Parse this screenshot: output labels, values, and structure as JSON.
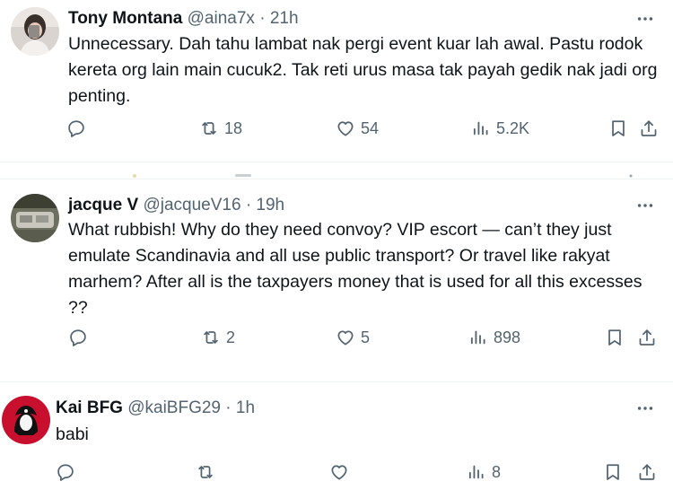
{
  "tweets": [
    {
      "name": "Tony Montana",
      "handle": "@aina7x",
      "dot": "·",
      "time": "21h",
      "text": "Unnecessary. Dah tahu lambat nak pergi event kuar lah awal. Pastu rodok kereta org lain main cucuk2. Tak reti urus masa tak payah gedik nak jadi org penting.",
      "replies": "",
      "retweets": "18",
      "likes": "54",
      "views": "5.2K"
    },
    {
      "name": "jacque V",
      "handle": "@jacqueV16",
      "dot": "·",
      "time": "19h",
      "text": "What rubbish! Why do they need convoy? VIP escort — can’t they just emulate Scandinavia and all use public transport? Or travel like rakyat marhem? After all is the taxpayers money that is used for all this excesses ??",
      "replies": "",
      "retweets": "2",
      "likes": "5",
      "views": "898"
    },
    {
      "name": "Kai BFG",
      "handle": "@kaiBFG29",
      "dot": "·",
      "time": "1h",
      "text": "babi",
      "replies": "",
      "retweets": "",
      "likes": "",
      "views": "8"
    }
  ],
  "icons": {
    "reply": "reply-icon",
    "retweet": "retweet-icon",
    "like": "like-icon",
    "views": "views-icon",
    "bookmark": "bookmark-icon",
    "share": "share-icon",
    "more": "more-icon"
  },
  "colors": {
    "text": "#0f1419",
    "secondary": "#536471",
    "divider": "#eff3f4"
  }
}
